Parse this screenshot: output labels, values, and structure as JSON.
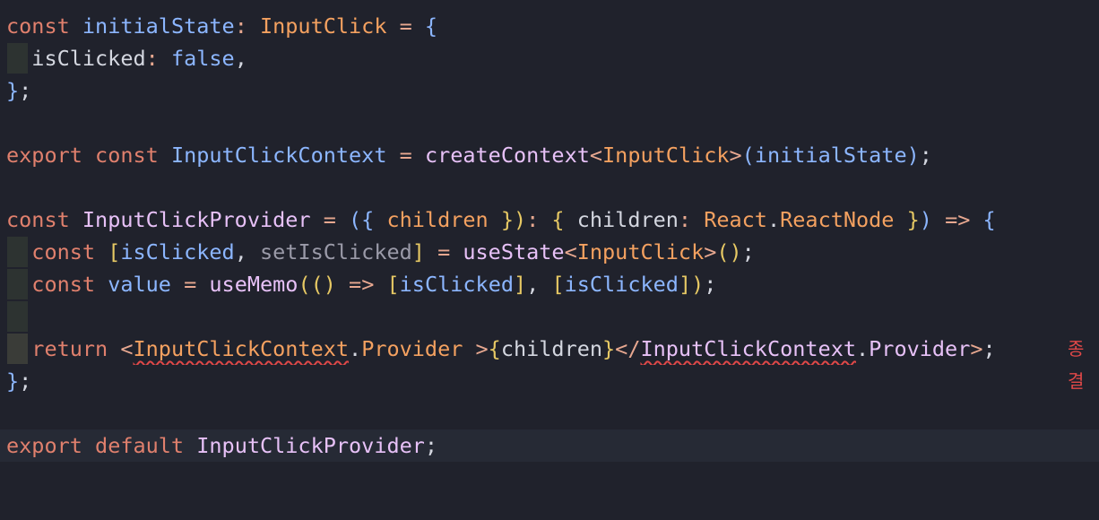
{
  "editor": {
    "lines": [
      [
        {
          "t": "const",
          "c": "kw"
        },
        {
          "t": " "
        },
        {
          "t": "initialState",
          "c": "def"
        },
        {
          "t": ": ",
          "c": "op"
        },
        {
          "t": "InputClick",
          "c": "type"
        },
        {
          "t": " = ",
          "c": "op"
        },
        {
          "t": "{",
          "c": "brc"
        }
      ],
      [
        {
          "t": "  isClicked",
          "c": "var"
        },
        {
          "t": ": ",
          "c": "op"
        },
        {
          "t": "false",
          "c": "bool"
        },
        {
          "t": ",",
          "c": "var"
        }
      ],
      [
        {
          "t": "}",
          "c": "brc"
        },
        {
          "t": ";",
          "c": "var"
        }
      ],
      [],
      [
        {
          "t": "export",
          "c": "kw"
        },
        {
          "t": " "
        },
        {
          "t": "const",
          "c": "kw"
        },
        {
          "t": " "
        },
        {
          "t": "InputClickContext",
          "c": "def"
        },
        {
          "t": " = ",
          "c": "op"
        },
        {
          "t": "createContext",
          "c": "fn"
        },
        {
          "t": "<",
          "c": "op"
        },
        {
          "t": "InputClick",
          "c": "type"
        },
        {
          "t": ">",
          "c": "op"
        },
        {
          "t": "(",
          "c": "brc"
        },
        {
          "t": "initialState",
          "c": "def"
        },
        {
          "t": ")",
          "c": "brc"
        },
        {
          "t": ";",
          "c": "var"
        }
      ],
      [],
      [
        {
          "t": "const",
          "c": "kw"
        },
        {
          "t": " "
        },
        {
          "t": "InputClickProvider",
          "c": "fn"
        },
        {
          "t": " = ",
          "c": "op"
        },
        {
          "t": "({",
          "c": "brc"
        },
        {
          "t": " "
        },
        {
          "t": "children",
          "c": "type"
        },
        {
          "t": " "
        },
        {
          "t": "})",
          "c": "brk"
        },
        {
          "t": ": ",
          "c": "op"
        },
        {
          "t": "{",
          "c": "brk"
        },
        {
          "t": " children",
          "c": "var"
        },
        {
          "t": ": ",
          "c": "op"
        },
        {
          "t": "React",
          "c": "type"
        },
        {
          "t": ".",
          "c": "var"
        },
        {
          "t": "ReactNode",
          "c": "type"
        },
        {
          "t": " "
        },
        {
          "t": "}",
          "c": "brk"
        },
        {
          "t": ")",
          "c": "brc"
        },
        {
          "t": " => ",
          "c": "op"
        },
        {
          "t": "{",
          "c": "brc"
        }
      ],
      [
        {
          "t": "  "
        },
        {
          "t": "const",
          "c": "kw"
        },
        {
          "t": " "
        },
        {
          "t": "[",
          "c": "brk"
        },
        {
          "t": "isClicked",
          "c": "def"
        },
        {
          "t": ", ",
          "c": "var"
        },
        {
          "t": "setIsClicked",
          "c": "mute"
        },
        {
          "t": "]",
          "c": "brk"
        },
        {
          "t": " = ",
          "c": "op"
        },
        {
          "t": "useState",
          "c": "fn"
        },
        {
          "t": "<",
          "c": "op"
        },
        {
          "t": "InputClick",
          "c": "type"
        },
        {
          "t": ">",
          "c": "op"
        },
        {
          "t": "()",
          "c": "brk"
        },
        {
          "t": ";",
          "c": "var"
        }
      ],
      [
        {
          "t": "  "
        },
        {
          "t": "const",
          "c": "kw"
        },
        {
          "t": " "
        },
        {
          "t": "value",
          "c": "def"
        },
        {
          "t": " = ",
          "c": "op"
        },
        {
          "t": "useMemo",
          "c": "fn"
        },
        {
          "t": "(",
          "c": "brk"
        },
        {
          "t": "()",
          "c": "brk"
        },
        {
          "t": " => ",
          "c": "op"
        },
        {
          "t": "[",
          "c": "brk"
        },
        {
          "t": "isClicked",
          "c": "def"
        },
        {
          "t": "]",
          "c": "brk"
        },
        {
          "t": ", ",
          "c": "var"
        },
        {
          "t": "[",
          "c": "brk"
        },
        {
          "t": "isClicked",
          "c": "def"
        },
        {
          "t": "]",
          "c": "brk"
        },
        {
          "t": ")",
          "c": "brk"
        },
        {
          "t": ";",
          "c": "var"
        }
      ],
      [],
      [
        {
          "t": "  "
        },
        {
          "t": "return",
          "c": "kw"
        },
        {
          "t": " "
        },
        {
          "t": "<",
          "c": "op"
        },
        {
          "t": "InputClickContext",
          "c": "type sq"
        },
        {
          "t": ".",
          "c": "var"
        },
        {
          "t": "Provider",
          "c": "type"
        },
        {
          "t": " >",
          "c": "op"
        },
        {
          "t": "{",
          "c": "brk"
        },
        {
          "t": "children",
          "c": "var"
        },
        {
          "t": "}",
          "c": "brk"
        },
        {
          "t": "</",
          "c": "op"
        },
        {
          "t": "InputClickContext",
          "c": "fn sq"
        },
        {
          "t": ".",
          "c": "var"
        },
        {
          "t": "Provider",
          "c": "fn"
        },
        {
          "t": ">",
          "c": "op"
        },
        {
          "t": ";",
          "c": "var"
        }
      ],
      [
        {
          "t": "}",
          "c": "brc"
        },
        {
          "t": ";",
          "c": "var"
        }
      ],
      [],
      [
        {
          "t": "export",
          "c": "kw"
        },
        {
          "t": " "
        },
        {
          "t": "default",
          "c": "kw"
        },
        {
          "t": " "
        },
        {
          "t": "InputClickProvider",
          "c": "fn"
        },
        {
          "t": ";",
          "c": "var"
        }
      ]
    ],
    "inline_hint": "종결"
  }
}
